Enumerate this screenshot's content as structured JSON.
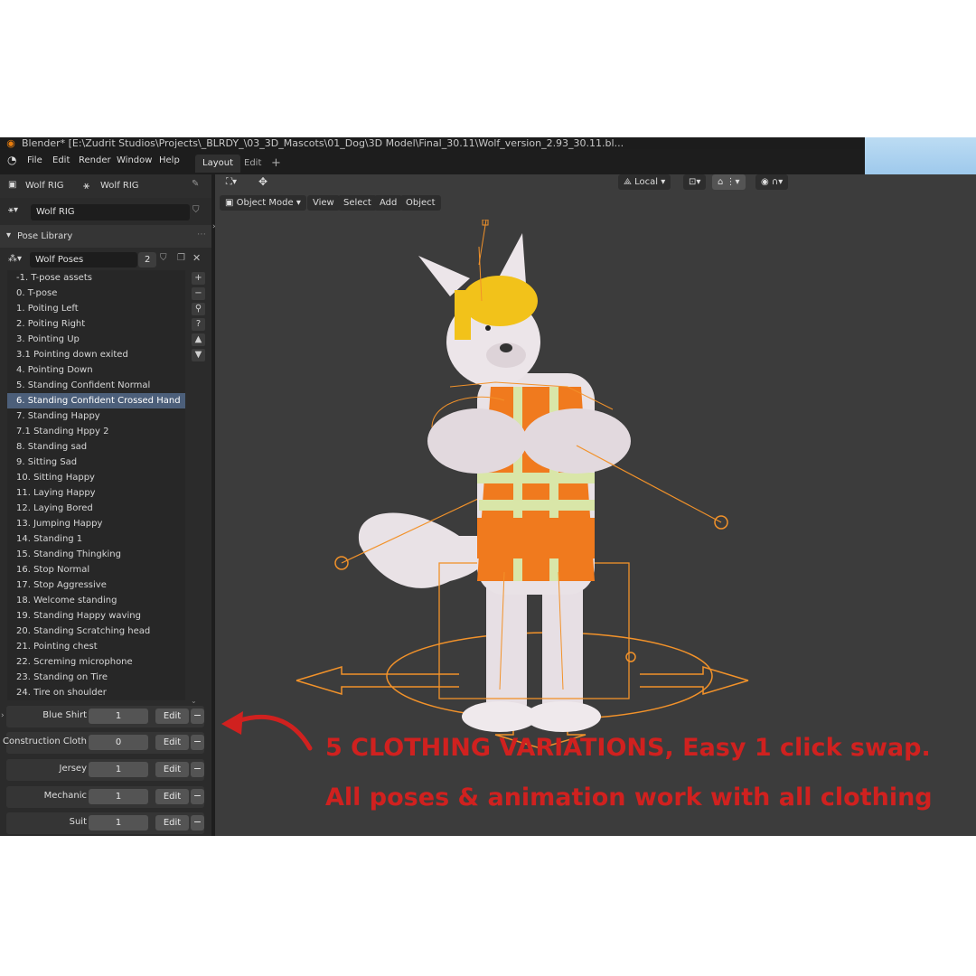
{
  "window": {
    "title": "Blender* [E:\\Zudrit Studios\\Projects\\_BLRDY_\\03_3D_Mascots\\01_Dog\\3D Model\\Final_30.11\\Wolf_version_2.93_30.11.bl..."
  },
  "menu": [
    "File",
    "Edit",
    "Render",
    "Window",
    "Help"
  ],
  "workspace_tabs": [
    {
      "label": "Layout",
      "active": true
    },
    {
      "label": "Edit",
      "active": false
    }
  ],
  "properties": {
    "breadcrumb_object": "Wolf RIG",
    "breadcrumb_armature": "Wolf RIG",
    "armature_field": "Wolf RIG",
    "panel_title": "Pose Library",
    "library_name": "Wolf Poses",
    "library_users": "2"
  },
  "poses": [
    "-1. T-pose assets",
    "0. T-pose",
    "1. Poiting Left",
    "2. Poiting Right",
    "3. Pointing Up",
    "3.1 Pointing down exited",
    "4. Pointing Down",
    "5. Standing Confident Normal",
    "6. Standing Confident Crossed Hand",
    "7. Standing Happy",
    "7.1 Standing Hppy 2",
    "8. Standing sad",
    "9. Sitting Sad",
    "10. Sitting Happy",
    "11. Laying Happy",
    "12. Laying Bored",
    "13. Jumping Happy",
    "14. Standing 1",
    "15. Standing Thingking",
    "16. Stop Normal",
    "17. Stop Aggressive",
    "18. Welcome standing",
    "19. Standing Happy waving",
    "20. Standing Scratching head",
    "21. Pointing chest",
    "22. Screming microphone",
    "23. Standing on Tire",
    "24. Tire on shoulder"
  ],
  "selected_pose": "6. Standing Confident Crossed Hand",
  "clothing": [
    {
      "name": "Blue Shirt",
      "value": "1",
      "edit": "Edit"
    },
    {
      "name": "Construction Cloth",
      "value": "0",
      "edit": "Edit"
    },
    {
      "name": "Jersey",
      "value": "1",
      "edit": "Edit"
    },
    {
      "name": "Mechanic",
      "value": "1",
      "edit": "Edit"
    },
    {
      "name": "Suit",
      "value": "1",
      "edit": "Edit"
    }
  ],
  "viewport": {
    "mode": "Object Mode",
    "menus": [
      "View",
      "Select",
      "Add",
      "Object"
    ],
    "transform_orientation": "Local"
  },
  "annotation": {
    "line1": "5 CLOTHING VARIATIONS, Easy 1 click swap.",
    "line2": "All poses & animation work with all clothing",
    "color": "#d0211f"
  },
  "colors": {
    "rig_orange": "#f2922a",
    "vest_orange": "#f07a1e",
    "helmet_yellow": "#f2c21a",
    "fur": "#e9e2e6",
    "selection_blue": "#4c5f7a"
  }
}
